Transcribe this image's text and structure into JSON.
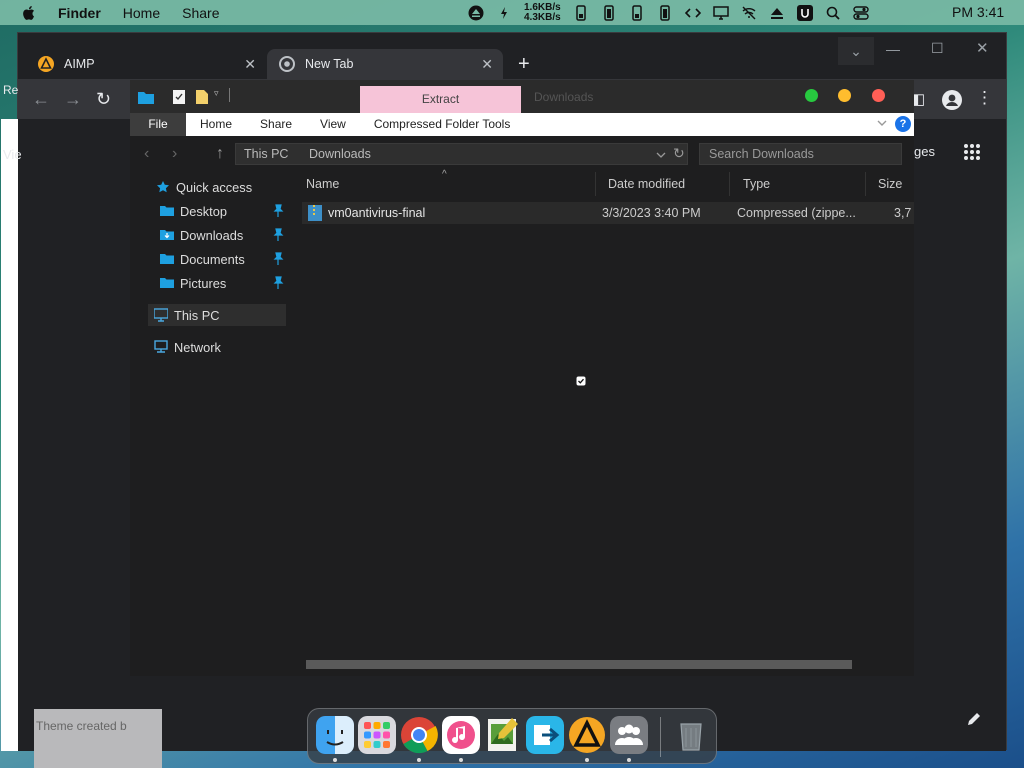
{
  "menubar": {
    "app_name": "Finder",
    "items": [
      "Home",
      "Share"
    ],
    "net_up": "1.6KB/s",
    "net_down": "4.3KB/s",
    "clock": "PM 3:41"
  },
  "browser": {
    "tabs": [
      {
        "label": "AIMP"
      },
      {
        "label": "New Tab"
      }
    ],
    "side_fragments": [
      "Re",
      "Vie"
    ],
    "right_fragment": "ges",
    "theme_credit": "Theme created b"
  },
  "explorer": {
    "contextual_tab": "Extract",
    "title": "Downloads",
    "ribbon_tabs": {
      "file": "File",
      "home": "Home",
      "share": "Share",
      "view": "View",
      "tools": "Compressed Folder Tools"
    },
    "help": "?",
    "breadcrumb": [
      "This PC",
      "Downloads"
    ],
    "search": {
      "placeholder": "Search Downloads"
    },
    "nav": {
      "quick_access": "Quick access",
      "desktop": "Desktop",
      "downloads": "Downloads",
      "documents": "Documents",
      "pictures": "Pictures",
      "this_pc": "This PC",
      "network": "Network"
    },
    "columns": {
      "name": "Name",
      "date": "Date modified",
      "type": "Type",
      "size": "Size"
    },
    "files": [
      {
        "name": "vm0antivirus-final",
        "date": "3/3/2023 3:40 PM",
        "type": "Compressed (zippe...",
        "size": "3,7"
      }
    ]
  },
  "colors": {
    "extract_tab": "#f6c4d8",
    "traffic_green": "#27c93f",
    "traffic_yellow": "#ffbd2e",
    "traffic_red": "#ff5f56",
    "accent_blue": "#1a73e8"
  },
  "dock": {
    "apps": [
      "finder-icon",
      "launchpad-icon",
      "chrome-icon",
      "music-icon",
      "preview-icon",
      "migration-icon",
      "aimp-icon",
      "users-icon",
      "trash-icon"
    ]
  }
}
